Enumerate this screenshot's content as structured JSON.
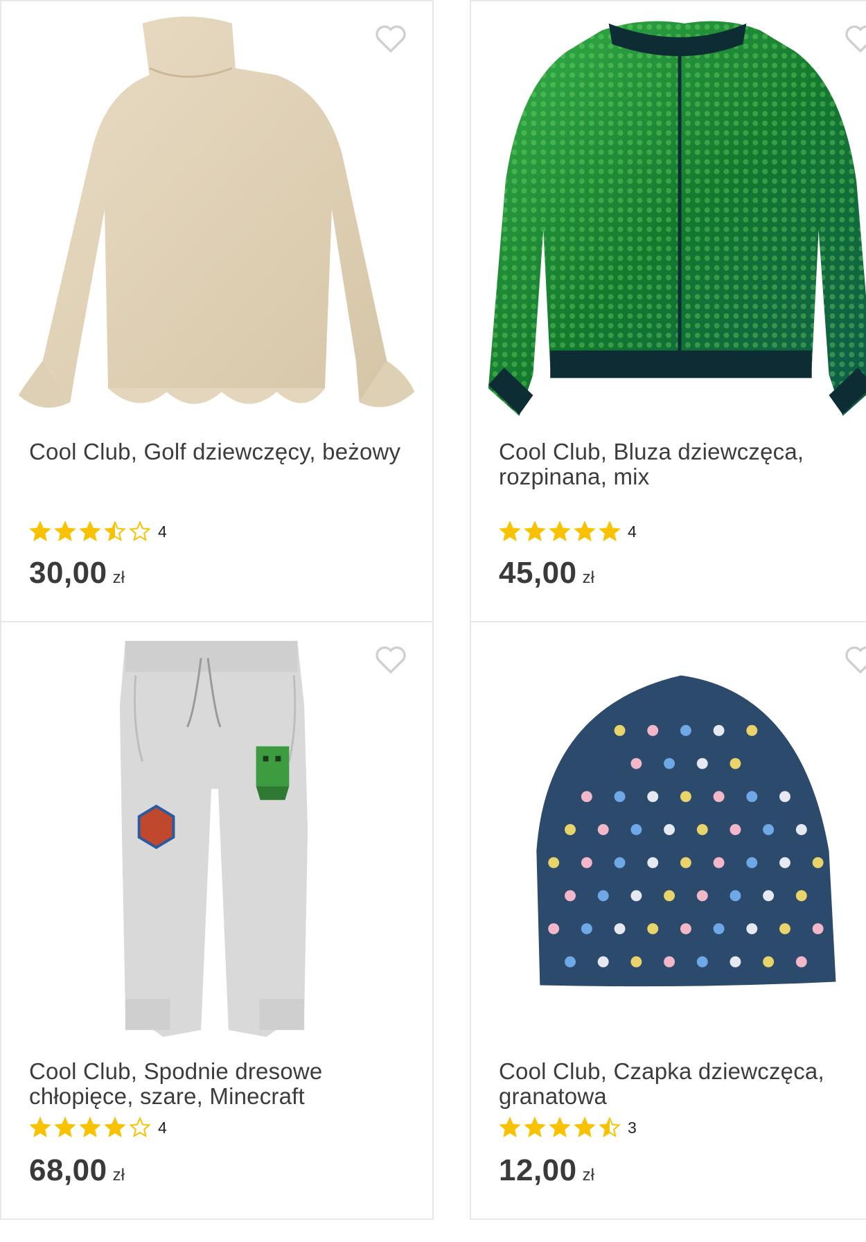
{
  "currency": "zł",
  "colors": {
    "star": "#F8C200",
    "border": "#e7e7e7",
    "heart": "#cfcfcf"
  },
  "products": [
    {
      "title": "Cool Club, Golf dziewczęcy, beżowy",
      "rating": 3.5,
      "reviews": "4",
      "price": "30,00",
      "image": "beige-ruffle-turtleneck-sweater",
      "favorite_icon": "heart-outline-icon"
    },
    {
      "title": "Cool Club, Bluza dziewczęca, rozpinana, mix",
      "rating": 5,
      "reviews": "4",
      "price": "45,00",
      "image": "green-sequin-bomber-jacket",
      "favorite_icon": "heart-outline-icon"
    },
    {
      "title": "Cool Club, Spodnie dresowe chłopięce, szare, Minecraft",
      "rating": 4,
      "reviews": "4",
      "price": "68,00",
      "image": "grey-minecraft-sweatpants",
      "favorite_icon": "heart-outline-icon"
    },
    {
      "title": "Cool Club, Czapka dziewczęca, granatowa",
      "rating": 4.5,
      "reviews": "3",
      "price": "12,00",
      "image": "navy-polka-dot-beanie",
      "favorite_icon": "heart-outline-icon"
    }
  ]
}
